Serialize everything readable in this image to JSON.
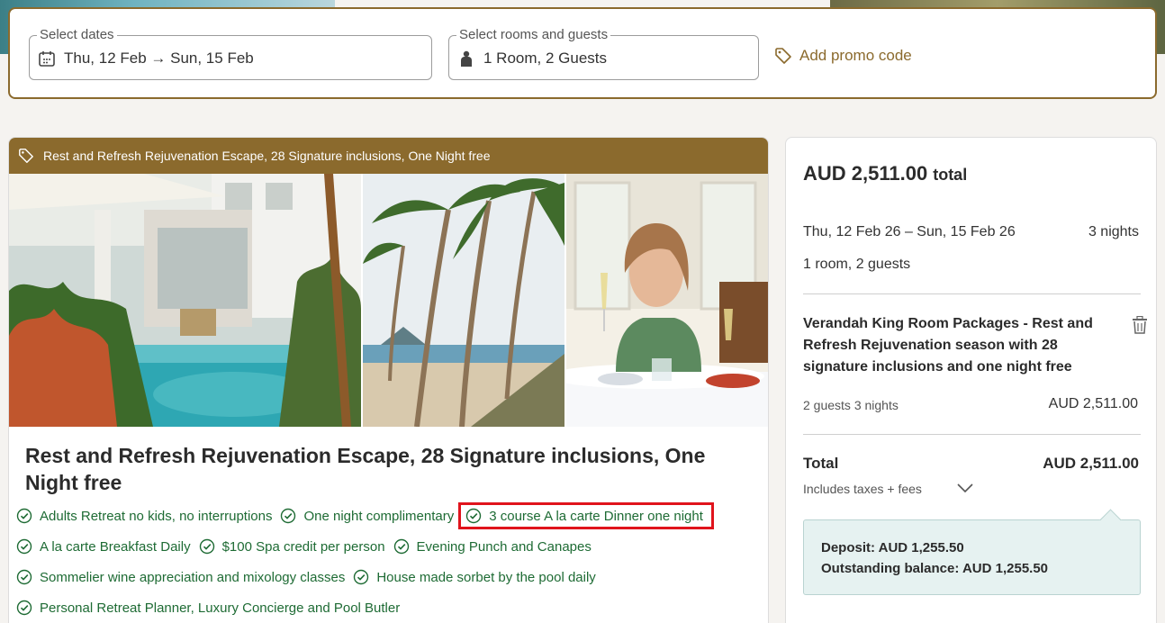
{
  "search": {
    "dates_label": "Select dates",
    "dates_value": "Thu, 12 Feb → Sun, 15 Feb",
    "rooms_label": "Select rooms and guests",
    "rooms_value": "1 Room, 2 Guests",
    "promo_label": "Add promo code"
  },
  "package": {
    "banner": "Rest and Refresh Rejuvenation Escape, 28 Signature inclusions, One Night free",
    "title": "Rest and Refresh Rejuvenation Escape, 28 Signature inclusions, One Night free",
    "images": [
      "pool-waterfall-photo",
      "palm-beach-photo",
      "dining-woman-photo"
    ],
    "inclusions": [
      "Adults Retreat no kids, no interruptions",
      "One night complimentary",
      "3 course A la carte Dinner one night",
      "A la carte Breakfast Daily",
      "$100 Spa credit per person",
      "Evening Punch and Canapes",
      "Sommelier wine appreciation and mixology classes",
      "House made sorbet by the pool daily",
      "Personal Retreat Planner, Luxury Concierge and Pool Butler"
    ]
  },
  "summary": {
    "total_amount": "AUD 2,511.00",
    "total_label": "total",
    "dates": "Thu, 12 Feb 26 – Sun, 15 Feb 26",
    "nights": "3 nights",
    "guests": "1 room, 2 guests",
    "room_name": "Verandah King Room Packages - Rest and Refresh Rejuvenation season with 28 signature inclusions and one night free",
    "room_meta": "2 guests 3 nights",
    "room_price": "AUD 2,511.00",
    "total_row_label": "Total",
    "total_row_value": "AUD 2,511.00",
    "taxes_note": "Includes taxes + fees",
    "deposit": "Deposit: AUD 1,255.50",
    "outstanding": "Outstanding balance: AUD 1,255.50"
  },
  "colors": {
    "brand": "#8b6a2d",
    "inclusion_green": "#1e6b34",
    "highlight_red": "#e0141c",
    "deposit_bg": "#e6f2f1"
  }
}
